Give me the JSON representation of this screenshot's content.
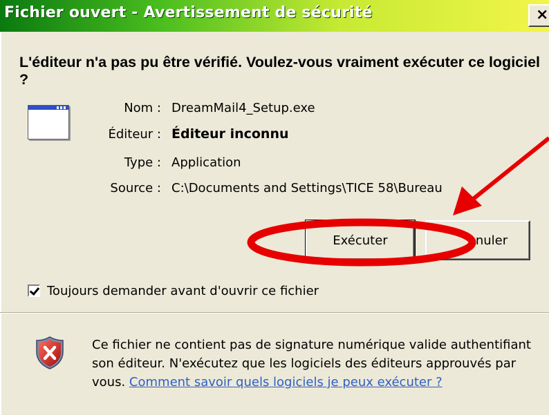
{
  "window": {
    "title": "Fichier ouvert - Avertissement de sécurité",
    "close_label": "×"
  },
  "dialog": {
    "question": "L'éditeur n'a pas pu être vérifié. Voulez-vous vraiment exécuter ce logiciel ?",
    "icon": "application-window-icon",
    "fields": [
      {
        "label": "Nom :",
        "value": "DreamMail4_Setup.exe"
      },
      {
        "label": "Éditeur :",
        "value": "Éditeur inconnu"
      },
      {
        "label": "Type :",
        "value": "Application"
      },
      {
        "label": "Source :",
        "value": "C:\\Documents and Settings\\TICE 58\\Bureau"
      }
    ],
    "buttons": {
      "run": "Exécuter",
      "cancel": "nuler"
    },
    "checkbox": {
      "label": "Toujours demander avant d'ouvrir ce fichier",
      "checked": true
    },
    "warning": {
      "text": "Ce fichier ne contient pas de signature numérique valide authentifiant son éditeur. N'exécutez que les logiciels des éditeurs approuvés par vous.",
      "link": "Comment savoir quels logiciels je peux exécuter ?",
      "icon": "shield-warning-icon"
    }
  },
  "colors": {
    "title_gradient_start": "#0a7a10",
    "title_gradient_end": "#f2f54a",
    "annotation_red": "#e60000",
    "link_blue": "#2f5fc3"
  }
}
